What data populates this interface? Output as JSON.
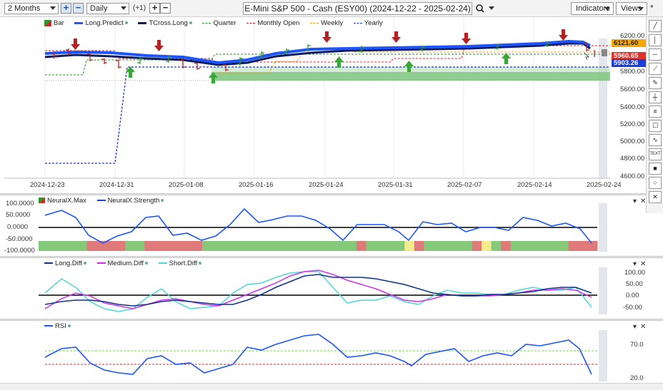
{
  "toolbar": {
    "period_select": "2 Months",
    "interval_select": "Daily",
    "offset_text": "(+1)",
    "title": "E-Mini S&P 500 - Cash (ESY00) (2024-12-22 - 2025-02-24)",
    "indicators_label": "Indicators",
    "views_label": "Views",
    "star": "*"
  },
  "price_pane": {
    "legend": [
      "Bar",
      "Long.Predict",
      "TCross.Long",
      "Quarter",
      "Monthly Open",
      "Weekly",
      "Yearly"
    ],
    "y_ticks": [
      "6200.00",
      "6000.00",
      "5800.00",
      "5600.00",
      "5400.00",
      "5200.00",
      "5000.00",
      "4800.00",
      "4600.00"
    ],
    "x_ticks": [
      "2024-12-23",
      "2024-12-31",
      "2025-01-08",
      "2025-01-16",
      "2025-01-24",
      "2025-01-31",
      "2025-02-07",
      "2025-02-14",
      "2025-02-24"
    ],
    "price_tags": [
      {
        "text": "6121.60",
        "color": "#f6a800"
      },
      {
        "text": "5960.65",
        "color": "#e0312b"
      },
      {
        "text": "5903.26",
        "color": "#1c3fd6"
      }
    ],
    "colors": {
      "long_predict": "#1c55ff",
      "tcross": "#0b1b5e",
      "monthly": "#d62828",
      "weekly": "#f0a020",
      "yearly": "#2233cc",
      "quarter": "#2b8a2b",
      "up": "#3aa63a",
      "down": "#b32222"
    }
  },
  "neural_pane": {
    "legend": [
      "NeuralX.Max",
      "NeuralX.Strength"
    ],
    "y_ticks": [
      "100.0000",
      "50.0000",
      "0.0000",
      "-50.0000",
      "-100.0000"
    ],
    "strip": [
      "g",
      "g",
      "g",
      "g",
      "g",
      "r",
      "r",
      "r",
      "r",
      "g",
      "g",
      "r",
      "r",
      "r",
      "r",
      "r",
      "r",
      "g",
      "g",
      "g",
      "g",
      "g",
      "g",
      "g",
      "g",
      "g",
      "g",
      "g",
      "g",
      "g",
      "g",
      "g",
      "g",
      "r",
      "g",
      "g",
      "g",
      "g",
      "y",
      "r",
      "g",
      "g",
      "g",
      "g",
      "g",
      "r",
      "y",
      "g",
      "r",
      "g",
      "g",
      "g",
      "g",
      "g",
      "g",
      "r",
      "r",
      "r"
    ]
  },
  "diff_pane": {
    "legend": [
      "Long.Diff",
      "Medium.Diff",
      "Short.Diff"
    ],
    "y_ticks": [
      "100.00",
      "50.00",
      "0.00",
      "-50.00"
    ]
  },
  "rsi_pane": {
    "legend": [
      "RSI"
    ],
    "y_ticks": [
      "70.0",
      "20.0"
    ]
  },
  "tools": [
    "pencil",
    "vline",
    "hline",
    "ray",
    "brush",
    "crosshair",
    "fib",
    "comment",
    "wave",
    "text",
    "rect",
    "circle",
    "close"
  ],
  "tool_text": "TEXT"
}
